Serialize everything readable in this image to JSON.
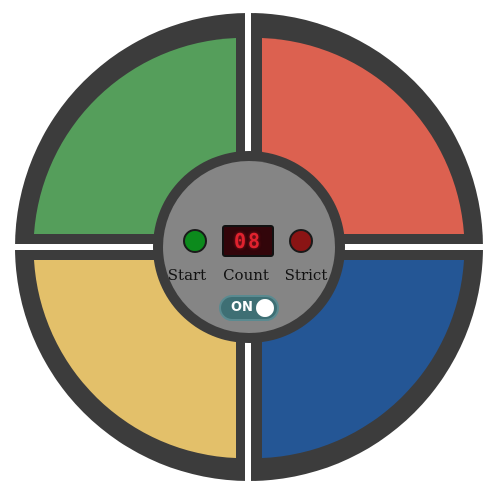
{
  "game": {
    "pads": [
      {
        "id": "green",
        "color": "#559e5b"
      },
      {
        "id": "red",
        "color": "#dc6150"
      },
      {
        "id": "yellow",
        "color": "#e3c06a"
      },
      {
        "id": "blue",
        "color": "#245695"
      }
    ],
    "bezel_color": "#3c3c3c",
    "hub_color": "#858585",
    "controls": {
      "start_label": "Start",
      "count_label": "Count",
      "strict_label": "Strict",
      "count_value": "08",
      "start_led_color": "#0c8a1c",
      "strict_led_color": "#8a1414",
      "power_label": "ON",
      "power_state": "on"
    }
  }
}
